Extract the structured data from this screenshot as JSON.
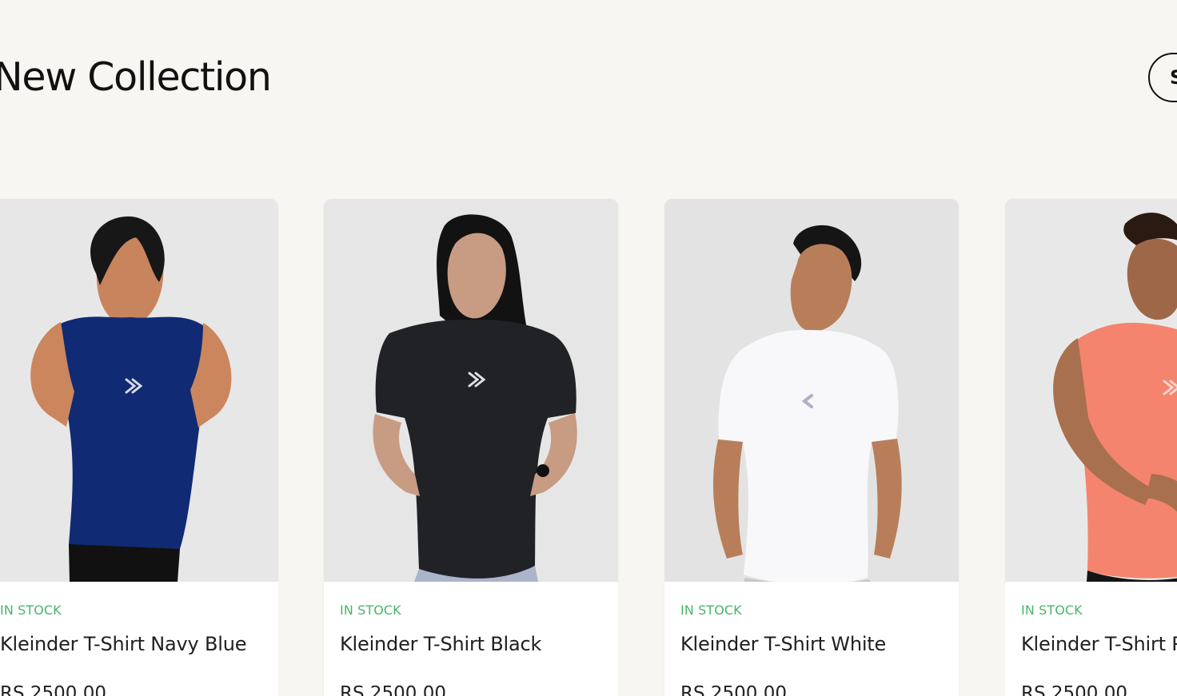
{
  "section": {
    "title": "New Collection",
    "see_all_label": "See All"
  },
  "products": [
    {
      "stock": "IN STOCK",
      "name": "Kleinder T-Shirt Navy Blue",
      "price": "RS.2500.00",
      "shirt_color": "#102a73"
    },
    {
      "stock": "IN STOCK",
      "name": "Kleinder T-Shirt Black",
      "price": "RS.2500.00",
      "shirt_color": "#202226"
    },
    {
      "stock": "IN STOCK",
      "name": "Kleinder T-Shirt White",
      "price": "RS.2500.00",
      "shirt_color": "#f8f8fb"
    },
    {
      "stock": "IN STOCK",
      "name": "Kleinder T-Shirt Pink",
      "price": "RS.2500.00",
      "shirt_color": "#f4846e"
    }
  ],
  "colors": {
    "page_background": "#f7f6f2",
    "stock_text": "#48b66a",
    "text": "#202020"
  },
  "icons": {
    "brand_mark": "chevron-logo-icon"
  }
}
